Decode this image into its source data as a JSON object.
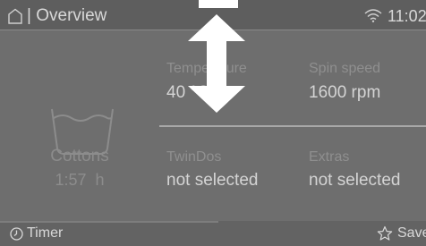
{
  "header": {
    "title": "Overview",
    "time": "11:02"
  },
  "program": {
    "name": "Cottons",
    "duration_value": "1:57",
    "duration_unit": "h"
  },
  "settings": [
    {
      "label": "Temperature",
      "value": "40 °C"
    },
    {
      "label": "Spin speed",
      "value": "1600 rpm"
    },
    {
      "label": "TwinDos",
      "value": "not selected"
    },
    {
      "label": "Extras",
      "value": "not selected"
    }
  ],
  "footer": {
    "timer_label": "Timer",
    "save_label": "Save"
  },
  "colors": {
    "background": "#6e6e6e",
    "topbar": "#5e5e5e",
    "overlay_arrow": "#ffffff"
  },
  "icons": [
    "home-icon",
    "wifi-icon",
    "washtub-icon",
    "clock-icon",
    "star-icon",
    "vertical-double-arrow-icon"
  ]
}
